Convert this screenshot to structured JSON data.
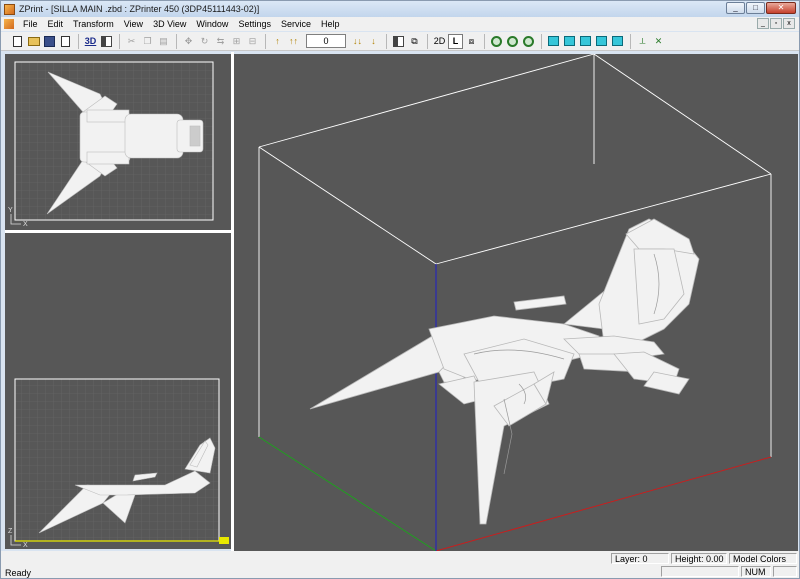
{
  "window": {
    "title": "ZPrint - [SILLA MAIN .zbd : ZPrinter 450 (3DP45111443-02)]",
    "minimize_glyph": "_",
    "maximize_glyph": "□",
    "close_glyph": "✕"
  },
  "menu": {
    "items": [
      "File",
      "Edit",
      "Transform",
      "View",
      "3D View",
      "Window",
      "Settings",
      "Service",
      "Help"
    ]
  },
  "mdi": {
    "minimize_glyph": "_",
    "restore_glyph": "▫",
    "close_glyph": "x"
  },
  "toolbar": {
    "view_3d_label": "3D",
    "mode_2d_label": "2D",
    "mode_l_label": "L",
    "layer_value": "0",
    "icons": [
      "new-icon",
      "open-icon",
      "save-icon",
      "import-icon",
      "3d-view-icon",
      "list-icon",
      "cut-icon",
      "copy-icon",
      "paste-icon",
      "move-icon",
      "rotate-icon",
      "mirror-icon",
      "scale-icon",
      "align-icon",
      "layer-up-icon",
      "layer-top-icon",
      "layer-down-icon",
      "layer-bottom-icon",
      "slice-icon",
      "clone-icon",
      "zoom-in-icon",
      "zoom-out-icon",
      "zoom-fit-icon",
      "view-top-icon",
      "view-front-icon",
      "view-side-icon",
      "view-iso-icon",
      "view-cube-icon",
      "measure-icon",
      "tool-icon"
    ]
  },
  "viewports": {
    "top_view": {
      "axis_y": "Y",
      "axis_x": "X"
    },
    "front_view": {
      "axis_z": "Z",
      "axis_x": "X"
    }
  },
  "status": {
    "ready": "Ready",
    "layer": "Layer: 0",
    "height": "Height: 0.00 mm",
    "model_colors": "Model Colors",
    "num": "NUM"
  },
  "colors": {
    "viewport_bg": "#575757",
    "grid": "#6a6a6a",
    "axis_x": "#c81e1e",
    "axis_y": "#1ea01e",
    "axis_z": "#1e1ec8",
    "model": "#f2f2f2",
    "front_baseline": "#e8e800"
  }
}
